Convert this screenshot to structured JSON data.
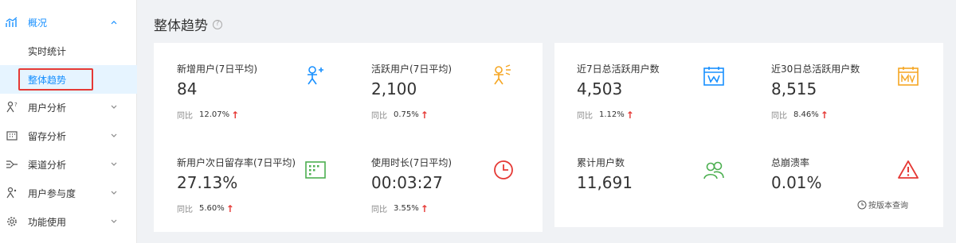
{
  "sidebar": {
    "overview": {
      "label": "概况",
      "icon": "chart-line-icon"
    },
    "sub_items": [
      {
        "label": "实时统计"
      },
      {
        "label": "整体趋势"
      }
    ],
    "items": [
      {
        "label": "用户分析",
        "icon": "user-question-icon"
      },
      {
        "label": "留存分析",
        "icon": "calendar-grid-icon"
      },
      {
        "label": "渠道分析",
        "icon": "channel-split-icon"
      },
      {
        "label": "用户参与度",
        "icon": "user-engagement-icon"
      },
      {
        "label": "功能使用",
        "icon": "gear-icon"
      }
    ]
  },
  "page": {
    "title": "整体趋势"
  },
  "left_card": {
    "metrics": [
      {
        "label": "新增用户(7日平均)",
        "value": "84",
        "cmp_label": "同比",
        "cmp_pct": "12.07%",
        "icon": "add-user-icon"
      },
      {
        "label": "活跃用户(7日平均)",
        "value": "2,100",
        "cmp_label": "同比",
        "cmp_pct": "0.75%",
        "icon": "active-user-icon"
      },
      {
        "label": "新用户次日留存率(7日平均)",
        "value": "27.13%",
        "cmp_label": "同比",
        "cmp_pct": "5.60%",
        "icon": "retention-grid-icon"
      },
      {
        "label": "使用时长(7日平均)",
        "value": "00:03:27",
        "cmp_label": "同比",
        "cmp_pct": "3.55%",
        "icon": "clock-icon"
      }
    ]
  },
  "right_card": {
    "metrics": [
      {
        "label": "近7日总活跃用户数",
        "value": "4,503",
        "cmp_label": "同比",
        "cmp_pct": "1.12%",
        "icon": "week-calendar-icon"
      },
      {
        "label": "近30日总活跃用户数",
        "value": "8,515",
        "cmp_label": "同比",
        "cmp_pct": "8.46%",
        "icon": "month-calendar-icon"
      },
      {
        "label": "累计用户数",
        "value": "11,691",
        "icon": "users-group-icon"
      },
      {
        "label": "总崩溃率",
        "value": "0.01%",
        "icon": "warning-icon"
      }
    ],
    "version_query": "按版本查询"
  },
  "colors": {
    "accent": "#1890ff",
    "up_arrow": "#e53935",
    "orange": "#f5a623",
    "green": "#4caf50",
    "red": "#e53935"
  }
}
